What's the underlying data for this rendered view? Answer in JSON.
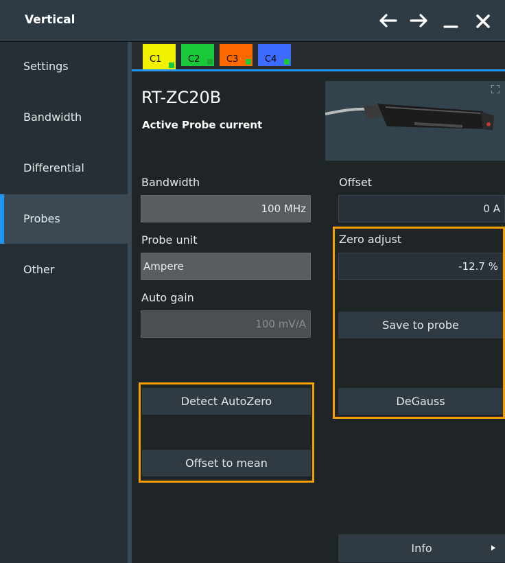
{
  "window": {
    "title": "Vertical"
  },
  "colors": {
    "accent": "#2196f3",
    "highlight": "#f5a000",
    "ch1": "#f2f200",
    "ch2": "#19c93a",
    "ch3": "#ff6a00",
    "ch4": "#3c6cff"
  },
  "titlebar_icons": [
    "back-arrow-icon",
    "forward-arrow-icon",
    "minimize-icon",
    "close-icon"
  ],
  "sidebar": {
    "items": [
      {
        "label": "Settings"
      },
      {
        "label": "Bandwidth"
      },
      {
        "label": "Differential"
      },
      {
        "label": "Probes",
        "active": true
      },
      {
        "label": "Other"
      }
    ]
  },
  "tabs": [
    {
      "label": "C1",
      "active": true
    },
    {
      "label": "C2"
    },
    {
      "label": "C3"
    },
    {
      "label": "C4"
    }
  ],
  "probe": {
    "name": "RT-ZC20B",
    "description": "Active Probe current"
  },
  "bandwidth": {
    "label": "Bandwidth",
    "value": "100 MHz"
  },
  "probe_unit": {
    "label": "Probe unit",
    "value": "Ampere"
  },
  "auto_gain": {
    "label": "Auto gain",
    "value": "100 mV/A"
  },
  "offset": {
    "label": "Offset",
    "value": "0 A"
  },
  "zero_adjust": {
    "label": "Zero adjust",
    "value": "-12.7 %"
  },
  "buttons": {
    "save_to_probe": "Save to probe",
    "degauss": "DeGauss",
    "detect_autozero": "Detect AutoZero",
    "offset_to_mean": "Offset to mean",
    "info": "Info"
  }
}
